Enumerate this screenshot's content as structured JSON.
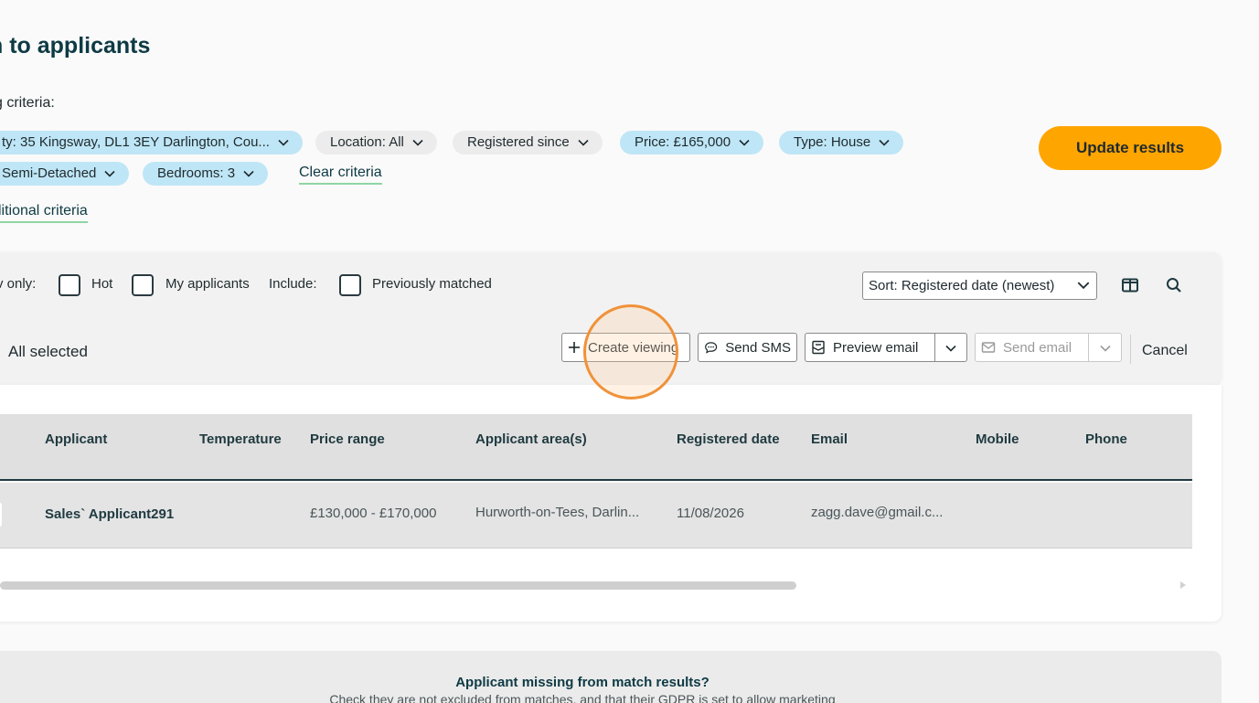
{
  "page": {
    "title": "h to applicants",
    "criteria_label": "g criteria:"
  },
  "criteria": {
    "chips_row1": [
      {
        "label": "ty: 35 Kingsway, DL1 3EY Darlington, Cou...",
        "color": "blue"
      },
      {
        "label": "Location: All",
        "color": "grey"
      },
      {
        "label": "Registered since",
        "color": "grey"
      },
      {
        "label": "Price: £165,000",
        "color": "blue"
      },
      {
        "label": "Type: House",
        "color": "blue"
      }
    ],
    "chips_row2": [
      {
        "label": "Semi-Detached",
        "color": "blue"
      },
      {
        "label": "Bedrooms: 3",
        "color": "blue"
      }
    ],
    "clear_label": "Clear criteria",
    "additional_label": "litional criteria",
    "update_label": "Update results"
  },
  "filters": {
    "show_only_label": "v only:",
    "hot_label": "Hot",
    "my_applicants_label": "My applicants",
    "include_label": "Include:",
    "previously_matched_label": "Previously matched",
    "sort_value": "Sort: Registered date (newest)"
  },
  "actions": {
    "all_selected": "All selected",
    "create_viewing": "Create viewing",
    "send_sms": "Send SMS",
    "preview_email": "Preview email",
    "send_email": "Send email",
    "cancel": "Cancel"
  },
  "table": {
    "headers": [
      "Applicant",
      "Temperature",
      "Price range",
      "Applicant area(s)",
      "Registered date",
      "Email",
      "Mobile",
      "Phone"
    ],
    "rows": [
      {
        "applicant": "Sales` Applicant291",
        "temperature": "",
        "price_range": "£130,000 - £170,000",
        "areas": "Hurworth-on-Tees, Darlin...",
        "registered": "11/08/2026",
        "email": "zagg.dave@gmail.c...",
        "mobile": "",
        "phone": ""
      }
    ]
  },
  "missing": {
    "title": "Applicant missing from match results?",
    "subtitle": "Check they are not excluded from matches, and that their GDPR is set to allow marketing"
  },
  "colors": {
    "chip_blue": "#bfe6f6",
    "chip_grey": "#ececec",
    "accent_orange": "#ffa500",
    "underline_green": "#8fd5a3",
    "heading": "#0e3a44"
  }
}
